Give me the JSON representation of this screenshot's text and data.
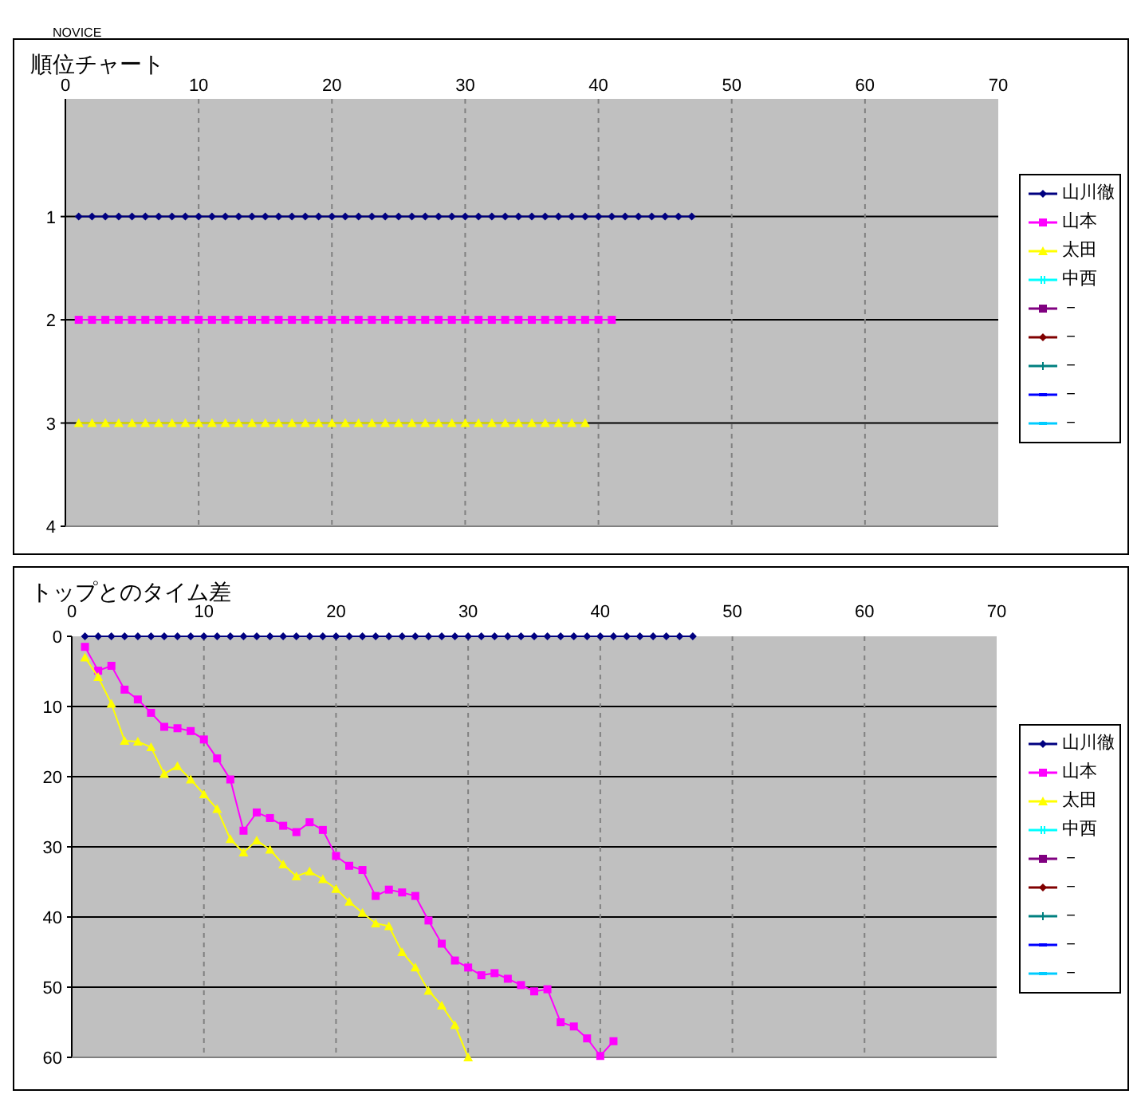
{
  "header": {
    "label": "NOVICE"
  },
  "charts": [
    {
      "chart_data": {
        "type": "line",
        "title": "順位チャート",
        "grid": true,
        "xlim": [
          0,
          70
        ],
        "ylim": [
          4,
          -0.14
        ],
        "xticks": [
          0,
          10,
          20,
          30,
          40,
          50,
          60,
          70
        ],
        "yticks": [
          1,
          2,
          3,
          4
        ],
        "x": [
          1,
          2,
          3,
          4,
          5,
          6,
          7,
          8,
          9,
          10,
          11,
          12,
          13,
          14,
          15,
          16,
          17,
          18,
          19,
          20,
          21,
          22,
          23,
          24,
          25,
          26,
          27,
          28,
          29,
          30,
          31,
          32,
          33,
          34,
          35,
          36,
          37,
          38,
          39,
          40,
          41,
          42,
          43,
          44,
          45,
          46,
          47
        ],
        "series": [
          {
            "name": "山川徹",
            "color": "#000080",
            "marker": "diamond",
            "values": [
              1,
              1,
              1,
              1,
              1,
              1,
              1,
              1,
              1,
              1,
              1,
              1,
              1,
              1,
              1,
              1,
              1,
              1,
              1,
              1,
              1,
              1,
              1,
              1,
              1,
              1,
              1,
              1,
              1,
              1,
              1,
              1,
              1,
              1,
              1,
              1,
              1,
              1,
              1,
              1,
              1,
              1,
              1,
              1,
              1,
              1,
              1
            ]
          },
          {
            "name": "山本",
            "color": "#ff00ff",
            "marker": "square",
            "values": [
              2,
              2,
              2,
              2,
              2,
              2,
              2,
              2,
              2,
              2,
              2,
              2,
              2,
              2,
              2,
              2,
              2,
              2,
              2,
              2,
              2,
              2,
              2,
              2,
              2,
              2,
              2,
              2,
              2,
              2,
              2,
              2,
              2,
              2,
              2,
              2,
              2,
              2,
              2,
              2,
              2,
              null,
              null,
              null,
              null,
              null,
              null
            ]
          },
          {
            "name": "太田",
            "color": "#ffff00",
            "marker": "triangle",
            "values": [
              3,
              3,
              3,
              3,
              3,
              3,
              3,
              3,
              3,
              3,
              3,
              3,
              3,
              3,
              3,
              3,
              3,
              3,
              3,
              3,
              3,
              3,
              3,
              3,
              3,
              3,
              3,
              3,
              3,
              3,
              3,
              3,
              3,
              3,
              3,
              3,
              3,
              3,
              3,
              null,
              null,
              null,
              null,
              null,
              null,
              null,
              null
            ]
          },
          {
            "name": "中西",
            "color": "#00ffff",
            "marker": "cross",
            "values": [
              null,
              null,
              null,
              null,
              null,
              null,
              null,
              null,
              null,
              null,
              null,
              null,
              null,
              null,
              null,
              null,
              null,
              null,
              null,
              null,
              null,
              null,
              null,
              null,
              null,
              null,
              null,
              null,
              null,
              null,
              null,
              null,
              null,
              null,
              null,
              null,
              null,
              null,
              null,
              null,
              null,
              null,
              null,
              null,
              null,
              null,
              null
            ]
          },
          {
            "name": "－",
            "color": "#800080",
            "marker": "square",
            "values": [
              null,
              null,
              null,
              null,
              null,
              null,
              null,
              null,
              null,
              null,
              null,
              null,
              null,
              null,
              null,
              null,
              null,
              null,
              null,
              null,
              null,
              null,
              null,
              null,
              null,
              null,
              null,
              null,
              null,
              null,
              null,
              null,
              null,
              null,
              null,
              null,
              null,
              null,
              null,
              null,
              null,
              null,
              null,
              null,
              null,
              null,
              null
            ]
          },
          {
            "name": "－",
            "color": "#800000",
            "marker": "diamond",
            "values": [
              null,
              null,
              null,
              null,
              null,
              null,
              null,
              null,
              null,
              null,
              null,
              null,
              null,
              null,
              null,
              null,
              null,
              null,
              null,
              null,
              null,
              null,
              null,
              null,
              null,
              null,
              null,
              null,
              null,
              null,
              null,
              null,
              null,
              null,
              null,
              null,
              null,
              null,
              null,
              null,
              null,
              null,
              null,
              null,
              null,
              null,
              null
            ]
          },
          {
            "name": "－",
            "color": "#008080",
            "marker": "plus",
            "values": [
              null,
              null,
              null,
              null,
              null,
              null,
              null,
              null,
              null,
              null,
              null,
              null,
              null,
              null,
              null,
              null,
              null,
              null,
              null,
              null,
              null,
              null,
              null,
              null,
              null,
              null,
              null,
              null,
              null,
              null,
              null,
              null,
              null,
              null,
              null,
              null,
              null,
              null,
              null,
              null,
              null,
              null,
              null,
              null,
              null,
              null,
              null
            ]
          },
          {
            "name": "－",
            "color": "#0000ff",
            "marker": "dash",
            "values": [
              null,
              null,
              null,
              null,
              null,
              null,
              null,
              null,
              null,
              null,
              null,
              null,
              null,
              null,
              null,
              null,
              null,
              null,
              null,
              null,
              null,
              null,
              null,
              null,
              null,
              null,
              null,
              null,
              null,
              null,
              null,
              null,
              null,
              null,
              null,
              null,
              null,
              null,
              null,
              null,
              null,
              null,
              null,
              null,
              null,
              null,
              null
            ]
          },
          {
            "name": "－",
            "color": "#00ccff",
            "marker": "dash",
            "values": [
              null,
              null,
              null,
              null,
              null,
              null,
              null,
              null,
              null,
              null,
              null,
              null,
              null,
              null,
              null,
              null,
              null,
              null,
              null,
              null,
              null,
              null,
              null,
              null,
              null,
              null,
              null,
              null,
              null,
              null,
              null,
              null,
              null,
              null,
              null,
              null,
              null,
              null,
              null,
              null,
              null,
              null,
              null,
              null,
              null,
              null,
              null
            ]
          }
        ]
      }
    },
    {
      "chart_data": {
        "type": "line",
        "title": "トップとのタイム差",
        "grid": true,
        "xlim": [
          0,
          70
        ],
        "ylim": [
          60,
          0
        ],
        "xticks": [
          0,
          10,
          20,
          30,
          40,
          50,
          60,
          70
        ],
        "yticks": [
          0,
          10,
          20,
          30,
          40,
          50,
          60
        ],
        "x": [
          1,
          2,
          3,
          4,
          5,
          6,
          7,
          8,
          9,
          10,
          11,
          12,
          13,
          14,
          15,
          16,
          17,
          18,
          19,
          20,
          21,
          22,
          23,
          24,
          25,
          26,
          27,
          28,
          29,
          30,
          31,
          32,
          33,
          34,
          35,
          36,
          37,
          38,
          39,
          40,
          41,
          42,
          43,
          44,
          45,
          46,
          47
        ],
        "series": [
          {
            "name": "山川徹",
            "color": "#000080",
            "marker": "diamond",
            "values": [
              0,
              0,
              0,
              0,
              0,
              0,
              0,
              0,
              0,
              0,
              0,
              0,
              0,
              0,
              0,
              0,
              0,
              0,
              0,
              0,
              0,
              0,
              0,
              0,
              0,
              0,
              0,
              0,
              0,
              0,
              0,
              0,
              0,
              0,
              0,
              0,
              0,
              0,
              0,
              0,
              0,
              0,
              0,
              0,
              0,
              0,
              0
            ]
          },
          {
            "name": "山本",
            "color": "#ff00ff",
            "marker": "square",
            "values": [
              1.5,
              4.9,
              4.2,
              7.6,
              9.0,
              10.9,
              12.9,
              13.1,
              13.5,
              14.7,
              17.4,
              20.4,
              27.7,
              25.1,
              25.9,
              27.0,
              27.9,
              26.5,
              27.6,
              31.3,
              32.7,
              33.3,
              37.0,
              36.1,
              36.5,
              37.0,
              40.5,
              43.8,
              46.2,
              47.2,
              48.3,
              48.0,
              48.8,
              49.7,
              50.6,
              50.3,
              55.0,
              55.6,
              57.3,
              59.8,
              57.7,
              null,
              null,
              null,
              null,
              null,
              null
            ]
          },
          {
            "name": "太田",
            "color": "#ffff00",
            "marker": "triangle",
            "values": [
              3.0,
              5.8,
              9.6,
              14.9,
              15.0,
              15.8,
              19.6,
              18.5,
              20.4,
              22.5,
              24.6,
              28.9,
              30.8,
              29.1,
              30.4,
              32.5,
              34.2,
              33.5,
              34.6,
              36.0,
              37.8,
              39.4,
              40.9,
              41.3,
              45.0,
              47.2,
              50.5,
              52.6,
              55.4,
              60.0,
              null,
              null,
              null,
              null,
              null,
              null,
              null,
              null,
              null,
              null,
              null,
              null,
              null,
              null,
              null,
              null,
              null
            ]
          },
          {
            "name": "中西",
            "color": "#00ffff",
            "marker": "cross",
            "values": [
              null,
              null,
              null,
              null,
              null,
              null,
              null,
              null,
              null,
              null,
              null,
              null,
              null,
              null,
              null,
              null,
              null,
              null,
              null,
              null,
              null,
              null,
              null,
              null,
              null,
              null,
              null,
              null,
              null,
              null,
              null,
              null,
              null,
              null,
              null,
              null,
              null,
              null,
              null,
              null,
              null,
              null,
              null,
              null,
              null,
              null,
              null
            ]
          },
          {
            "name": "－",
            "color": "#800080",
            "marker": "square",
            "values": [
              null,
              null,
              null,
              null,
              null,
              null,
              null,
              null,
              null,
              null,
              null,
              null,
              null,
              null,
              null,
              null,
              null,
              null,
              null,
              null,
              null,
              null,
              null,
              null,
              null,
              null,
              null,
              null,
              null,
              null,
              null,
              null,
              null,
              null,
              null,
              null,
              null,
              null,
              null,
              null,
              null,
              null,
              null,
              null,
              null,
              null,
              null
            ]
          },
          {
            "name": "－",
            "color": "#800000",
            "marker": "diamond",
            "values": [
              null,
              null,
              null,
              null,
              null,
              null,
              null,
              null,
              null,
              null,
              null,
              null,
              null,
              null,
              null,
              null,
              null,
              null,
              null,
              null,
              null,
              null,
              null,
              null,
              null,
              null,
              null,
              null,
              null,
              null,
              null,
              null,
              null,
              null,
              null,
              null,
              null,
              null,
              null,
              null,
              null,
              null,
              null,
              null,
              null,
              null,
              null
            ]
          },
          {
            "name": "－",
            "color": "#008080",
            "marker": "plus",
            "values": [
              null,
              null,
              null,
              null,
              null,
              null,
              null,
              null,
              null,
              null,
              null,
              null,
              null,
              null,
              null,
              null,
              null,
              null,
              null,
              null,
              null,
              null,
              null,
              null,
              null,
              null,
              null,
              null,
              null,
              null,
              null,
              null,
              null,
              null,
              null,
              null,
              null,
              null,
              null,
              null,
              null,
              null,
              null,
              null,
              null,
              null,
              null
            ]
          },
          {
            "name": "－",
            "color": "#0000ff",
            "marker": "dash",
            "values": [
              null,
              null,
              null,
              null,
              null,
              null,
              null,
              null,
              null,
              null,
              null,
              null,
              null,
              null,
              null,
              null,
              null,
              null,
              null,
              null,
              null,
              null,
              null,
              null,
              null,
              null,
              null,
              null,
              null,
              null,
              null,
              null,
              null,
              null,
              null,
              null,
              null,
              null,
              null,
              null,
              null,
              null,
              null,
              null,
              null,
              null,
              null
            ]
          },
          {
            "name": "－",
            "color": "#00ccff",
            "marker": "dash",
            "values": [
              null,
              null,
              null,
              null,
              null,
              null,
              null,
              null,
              null,
              null,
              null,
              null,
              null,
              null,
              null,
              null,
              null,
              null,
              null,
              null,
              null,
              null,
              null,
              null,
              null,
              null,
              null,
              null,
              null,
              null,
              null,
              null,
              null,
              null,
              null,
              null,
              null,
              null,
              null,
              null,
              null,
              null,
              null,
              null,
              null,
              null,
              null
            ]
          }
        ]
      }
    }
  ]
}
